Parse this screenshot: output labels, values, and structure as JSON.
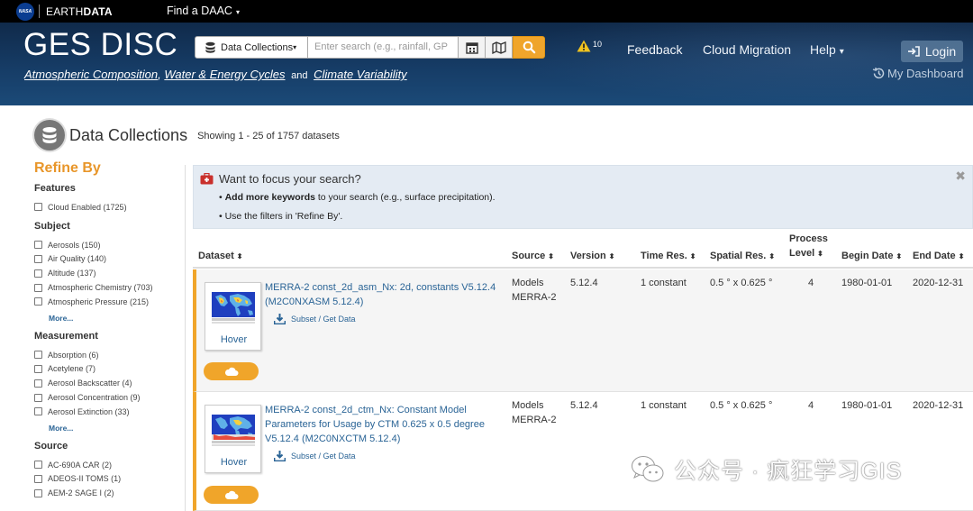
{
  "topbar": {
    "nasa_logo": "NASA",
    "earthdata_a": "EARTH",
    "earthdata_b": "DATA",
    "find_daac": "Find a DAAC",
    "find_daac_caret": "▾"
  },
  "banner": {
    "logo": "GES DISC",
    "tagline": {
      "link1": "Atmospheric Composition",
      "sep1": ",",
      "link2": "Water & Energy Cycles",
      "and": "and",
      "link3": "Climate Variability"
    },
    "search": {
      "dropdown_label": "Data Collections",
      "dropdown_caret": "▾",
      "placeholder": "Enter search (e.g., rainfall, GP"
    },
    "alerts_count": "10",
    "nav": {
      "feedback": "Feedback",
      "cloud_migration": "Cloud Migration",
      "help": "Help",
      "help_caret": "▾"
    },
    "login": "Login",
    "dashboard": "My Dashboard"
  },
  "header": {
    "title": "Data Collections",
    "showing": "Showing 1 - 25 of 1757 datasets"
  },
  "sidebar": {
    "refine_by": "Refine By",
    "sections": [
      {
        "title": "Features",
        "items": [
          "Cloud Enabled (1725)"
        ],
        "more": ""
      },
      {
        "title": "Subject",
        "items": [
          "Aerosols (150)",
          "Air Quality (140)",
          "Altitude (137)",
          "Atmospheric Chemistry (703)",
          "Atmospheric Pressure (215)"
        ],
        "more": "More..."
      },
      {
        "title": "Measurement",
        "items": [
          "Absorption (6)",
          "Acetylene (7)",
          "Aerosol Backscatter (4)",
          "Aerosol Concentration (9)",
          "Aerosol Extinction (33)"
        ],
        "more": "More..."
      },
      {
        "title": "Source",
        "items": [
          "AC-690A CAR (2)",
          "ADEOS-II TOMS (1)",
          "AEM-2 SAGE I (2)"
        ],
        "more": ""
      }
    ]
  },
  "alert": {
    "title": "Want to focus your search?",
    "bullet1_bold": "Add more keywords",
    "bullet1_rest": " to your search (e.g., surface precipitation).",
    "bullet2": "Use the filters in 'Refine By'.",
    "close": "✖"
  },
  "table": {
    "columns": {
      "dataset": "Dataset",
      "source": "Source",
      "version": "Version",
      "time_res": "Time Res.",
      "spatial_res": "Spatial Res.",
      "process_level_a": "Process",
      "process_level_b": "Level",
      "begin_date": "Begin Date",
      "end_date": "End Date"
    },
    "sort_glyph": "⬍",
    "rows": [
      {
        "title": "MERRA-2 const_2d_asm_Nx: 2d, constants V5.12.4 (M2C0NXASM 5.12.4)",
        "hover": "Hover",
        "subset": "Subset / Get Data",
        "source_a": "Models",
        "source_b": "MERRA-2",
        "version": "5.12.4",
        "time_res": "1 constant",
        "spatial_res": "0.5 ° x 0.625 °",
        "process_level": "4",
        "begin_date": "1980-01-01",
        "end_date": "2020-12-31"
      },
      {
        "title": "MERRA-2 const_2d_ctm_Nx: Constant Model Parameters for Usage by CTM 0.625 x 0.5 degree V5.12.4 (M2C0NXCTM 5.12.4)",
        "hover": "Hover",
        "subset": "Subset / Get Data",
        "source_a": "Models",
        "source_b": "MERRA-2",
        "version": "5.12.4",
        "time_res": "1 constant",
        "spatial_res": "0.5 ° x 0.625 °",
        "process_level": "4",
        "begin_date": "1980-01-01",
        "end_date": "2020-12-31"
      }
    ]
  },
  "watermark": {
    "text": "公众号 · 疯狂学习GIS"
  },
  "colors": {
    "accent": "#f0a52a",
    "link": "#2a6496",
    "banner": "#163c66",
    "refine": "#e8962a"
  }
}
